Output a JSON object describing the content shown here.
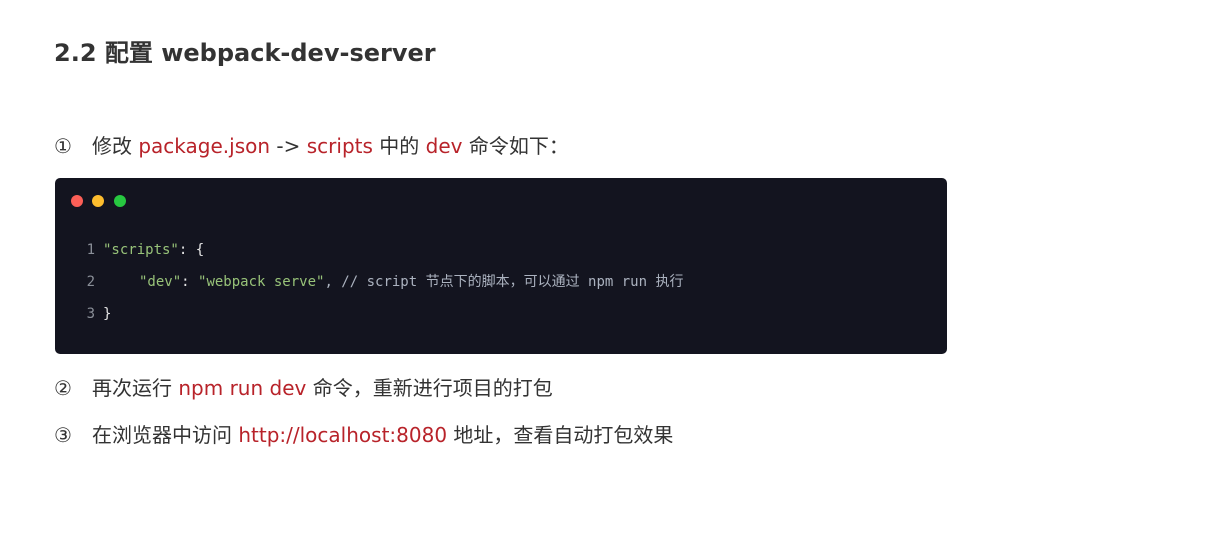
{
  "heading": "2.2 配置 webpack-dev-server",
  "steps": [
    {
      "num": "①",
      "parts": [
        "修改 ",
        "package.json",
        " -> ",
        "scripts",
        " 中的 ",
        "dev",
        " 命令如下："
      ]
    },
    {
      "num": "②",
      "parts": [
        "再次运行 ",
        "npm run dev",
        " 命令，重新进行项目的打包"
      ]
    },
    {
      "num": "③",
      "parts": [
        "在浏览器中访问 ",
        "http://localhost:8080",
        " 地址，查看自动打包效果"
      ]
    }
  ],
  "code": {
    "lines": [
      {
        "num": "1",
        "key": "\"scripts\"",
        "rest": ": {"
      },
      {
        "num": "2",
        "key": "\"dev\"",
        "colon": ": ",
        "value": "\"webpack serve\"",
        "comment": ", // script 节点下的脚本，可以通过 npm run 执行"
      },
      {
        "num": "3",
        "rest": "}"
      }
    ]
  },
  "colors": {
    "accent_red": "#b8232a",
    "code_bg": "#13141f",
    "string_green": "#98c379"
  }
}
